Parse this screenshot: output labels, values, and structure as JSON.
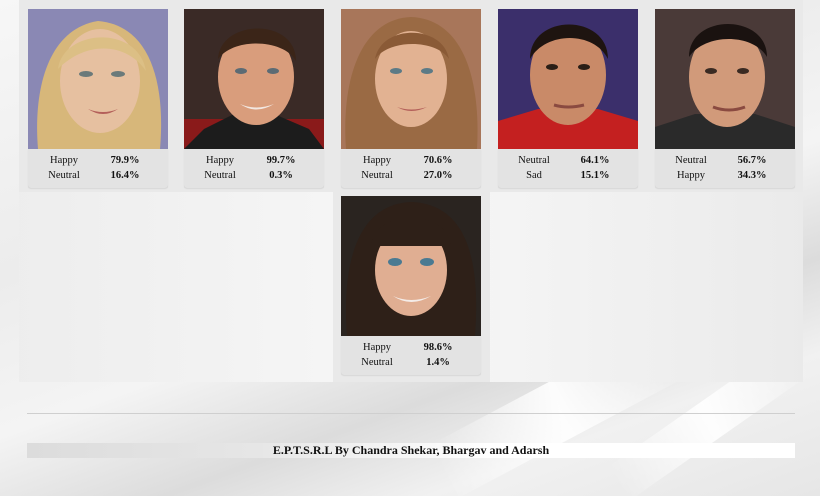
{
  "faces": [
    {
      "person": "blonde woman",
      "emotions": [
        {
          "label": "Happy",
          "value": "79.9%"
        },
        {
          "label": "Neutral",
          "value": "16.4%"
        }
      ]
    },
    {
      "person": "short-haired man",
      "emotions": [
        {
          "label": "Happy",
          "value": "99.7%"
        },
        {
          "label": "Neutral",
          "value": "0.3%"
        }
      ]
    },
    {
      "person": "woman with layered hair",
      "emotions": [
        {
          "label": "Happy",
          "value": "70.6%"
        },
        {
          "label": "Neutral",
          "value": "27.0%"
        }
      ]
    },
    {
      "person": "dark-haired man in red",
      "emotions": [
        {
          "label": "Neutral",
          "value": "64.1%"
        },
        {
          "label": "Sad",
          "value": "15.1%"
        }
      ]
    },
    {
      "person": "man with dark hair",
      "emotions": [
        {
          "label": "Neutral",
          "value": "56.7%"
        },
        {
          "label": "Happy",
          "value": "34.3%"
        }
      ]
    },
    {
      "person": "woman with bangs",
      "emotions": [
        {
          "label": "Happy",
          "value": "98.6%"
        },
        {
          "label": "Neutral",
          "value": "1.4%"
        }
      ]
    }
  ],
  "footer": {
    "text": "E.P.T.S.R.L By Chandra Shekar, Bhargav and Adarsh"
  }
}
